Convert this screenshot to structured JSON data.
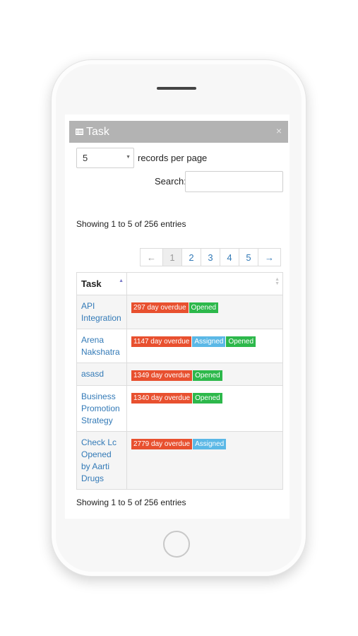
{
  "panel": {
    "title": "Task",
    "icon": "list-icon",
    "close": "×"
  },
  "length_select": {
    "value": "5",
    "label": "records per page"
  },
  "search": {
    "label": "Search:",
    "value": "",
    "placeholder": ""
  },
  "info_text": "Showing 1 to 5 of 256 entries",
  "pagination": {
    "prev": "←",
    "pages": [
      "1",
      "2",
      "3",
      "4",
      "5"
    ],
    "active": "1",
    "next": "→"
  },
  "table": {
    "headers": [
      "Task",
      ""
    ],
    "rows": [
      {
        "task": "API Integration",
        "badges": [
          {
            "text": "297 day overdue",
            "type": "overdue"
          },
          {
            "text": "Opened",
            "type": "opened"
          }
        ]
      },
      {
        "task": "Arena Nakshatra",
        "badges": [
          {
            "text": "1147 day overdue",
            "type": "overdue"
          },
          {
            "text": "Assigned",
            "type": "assigned"
          },
          {
            "text": "Opened",
            "type": "opened"
          }
        ]
      },
      {
        "task": "asasd",
        "badges": [
          {
            "text": "1349 day overdue",
            "type": "overdue"
          },
          {
            "text": "Opened",
            "type": "opened"
          }
        ]
      },
      {
        "task": "Business Promotion Strategy",
        "badges": [
          {
            "text": "1340 day overdue",
            "type": "overdue"
          },
          {
            "text": "Opened",
            "type": "opened"
          }
        ]
      },
      {
        "task": "Check Lc Opened by Aarti Drugs",
        "badges": [
          {
            "text": "2779 day overdue",
            "type": "overdue"
          },
          {
            "text": "Assigned",
            "type": "assigned"
          }
        ]
      }
    ]
  },
  "colors": {
    "overdue": "#e8502f",
    "opened": "#2db84b",
    "assigned": "#5bb8e6",
    "header": "#b3b3b3",
    "link": "#337ab7"
  }
}
